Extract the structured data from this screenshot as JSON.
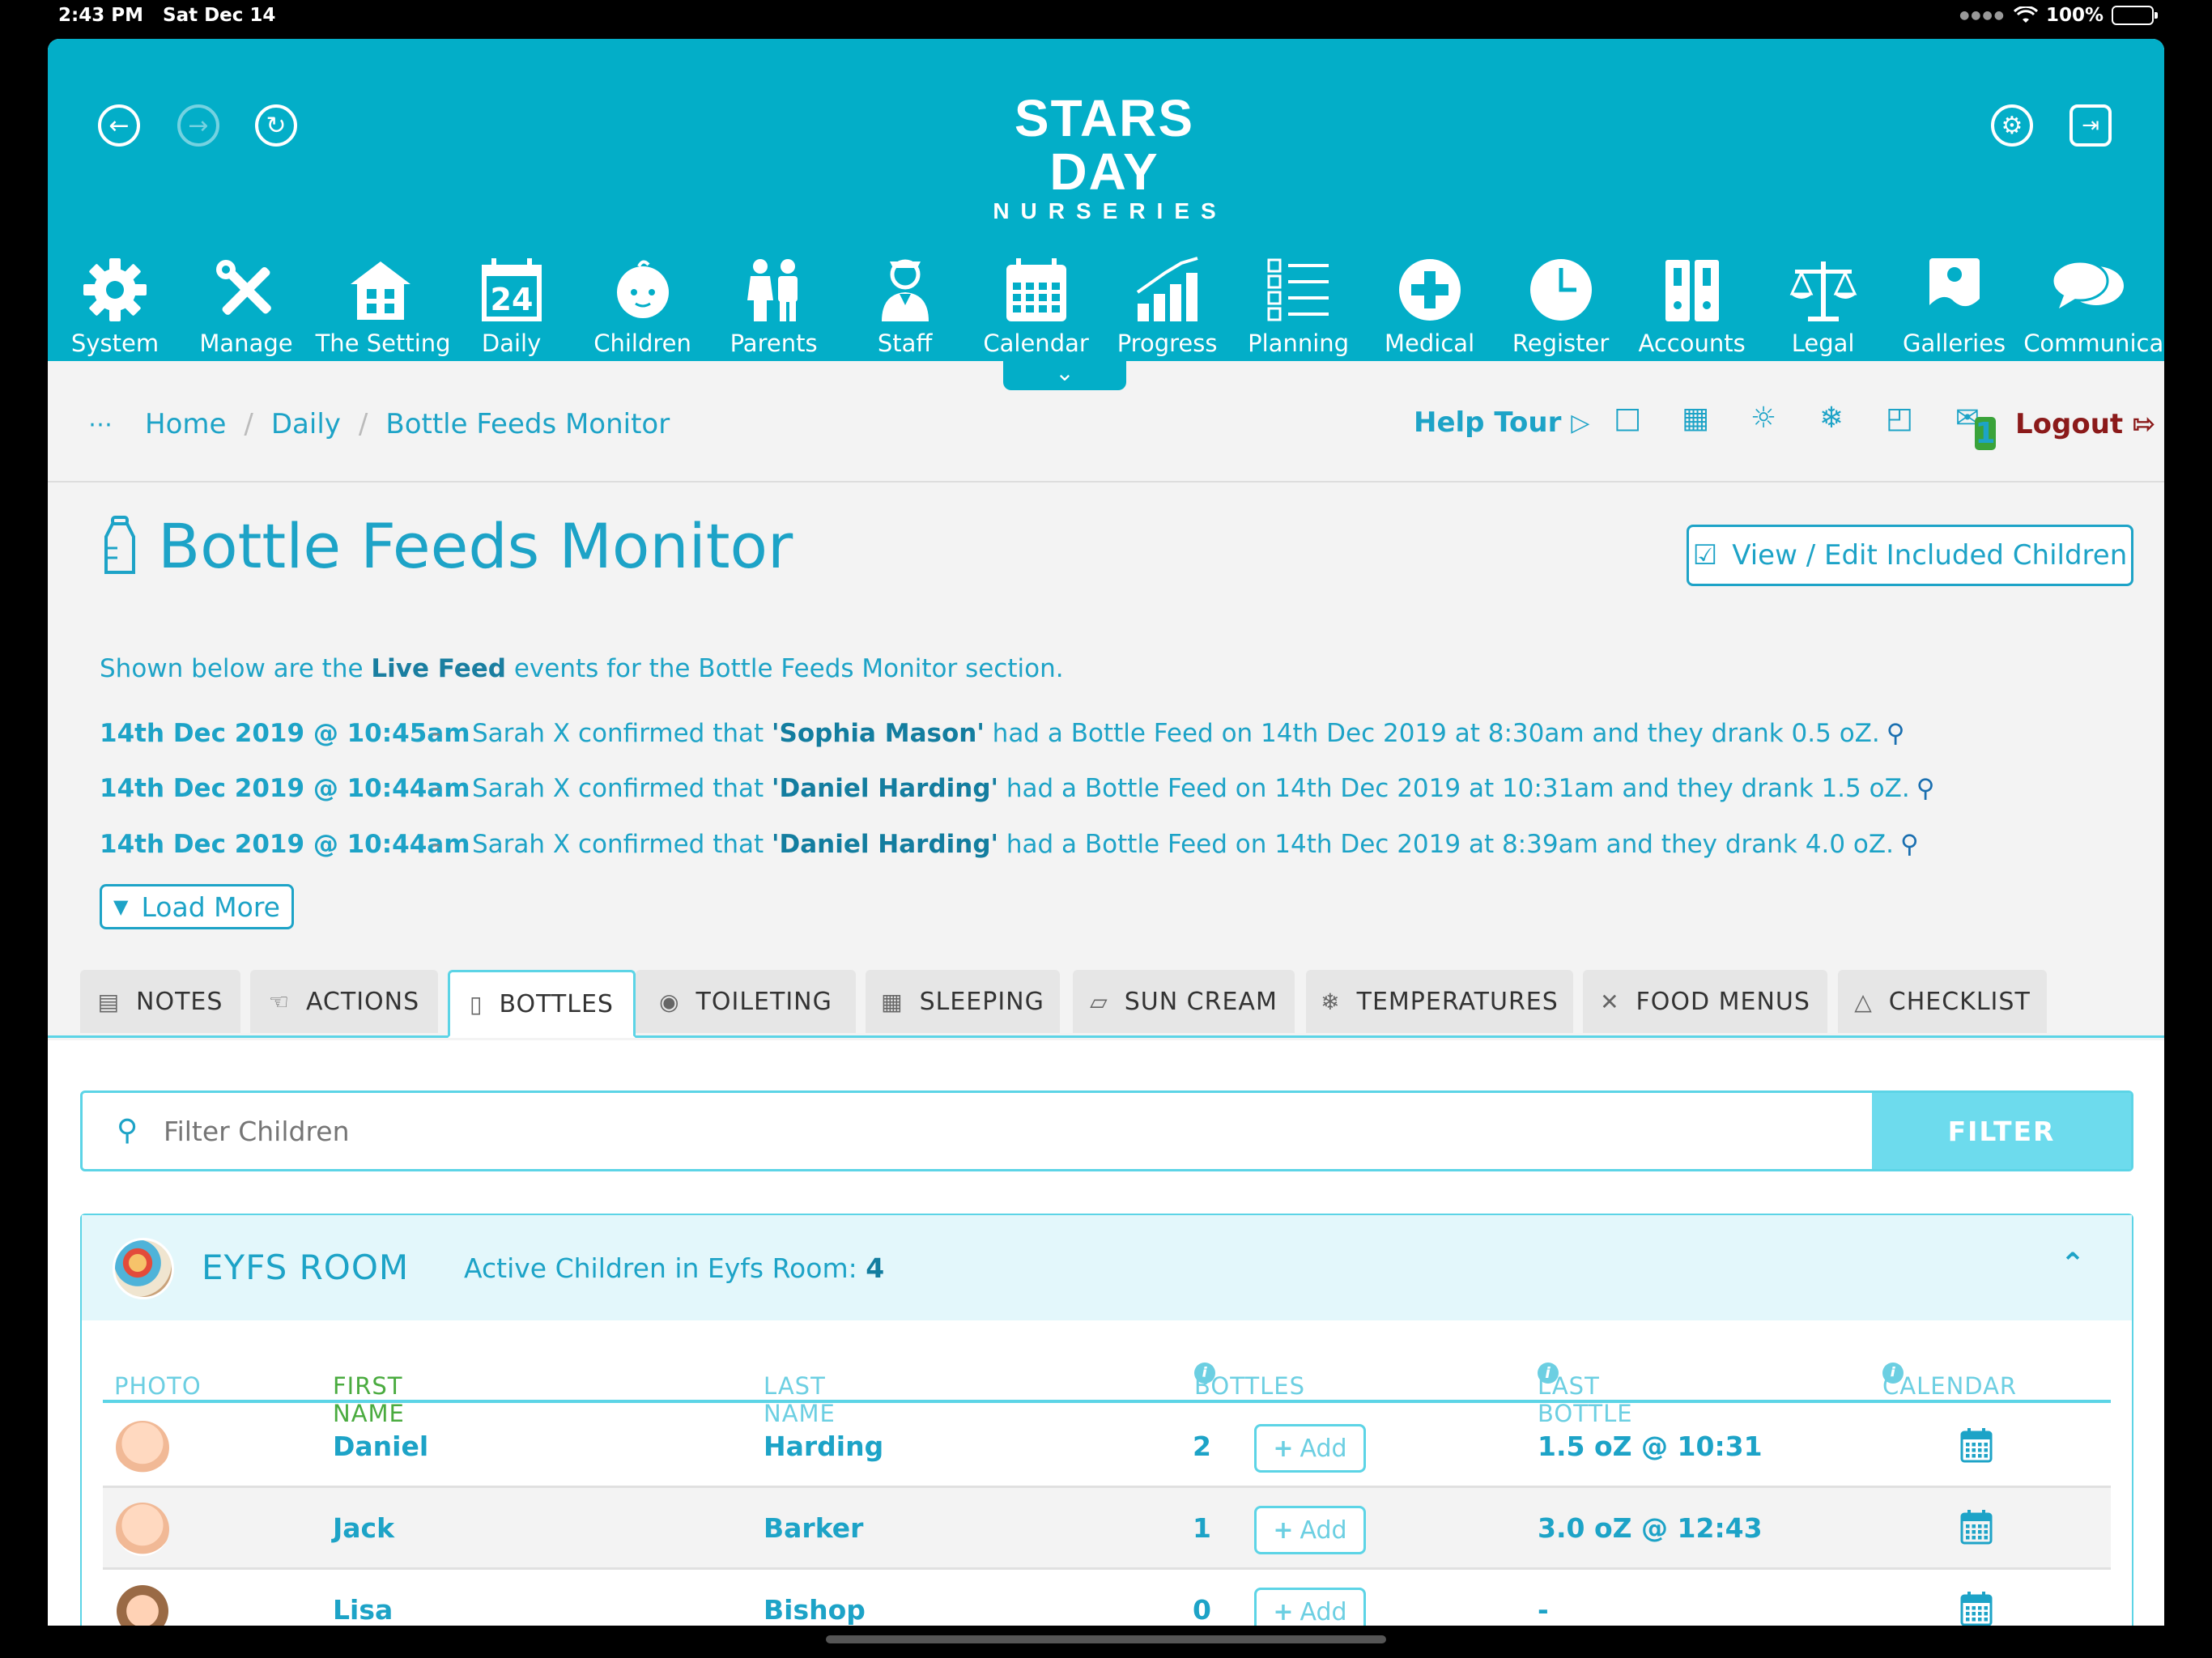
{
  "status": {
    "time": "2:43 PM",
    "date": "Sat Dec 14",
    "battery": "100%"
  },
  "brand": {
    "line1": "STARS DAY",
    "line2": "NURSERIES"
  },
  "nav": [
    {
      "label": "System",
      "icon": "gear-icon"
    },
    {
      "label": "Manage",
      "icon": "tools-icon"
    },
    {
      "label": "The Setting",
      "icon": "building-icon"
    },
    {
      "label": "Daily",
      "icon": "calendar-day-icon",
      "day": "24"
    },
    {
      "label": "Children",
      "icon": "baby-icon"
    },
    {
      "label": "Parents",
      "icon": "parents-icon"
    },
    {
      "label": "Staff",
      "icon": "staff-icon"
    },
    {
      "label": "Calendar",
      "icon": "calendar-grid-icon"
    },
    {
      "label": "Progress",
      "icon": "chart-icon"
    },
    {
      "label": "Planning",
      "icon": "checklist-icon"
    },
    {
      "label": "Medical",
      "icon": "medical-cross-icon"
    },
    {
      "label": "Register",
      "icon": "clock-icon"
    },
    {
      "label": "Accounts",
      "icon": "binders-icon"
    },
    {
      "label": "Legal",
      "icon": "scales-icon"
    },
    {
      "label": "Galleries",
      "icon": "gallery-icon"
    },
    {
      "label": "Communicate",
      "icon": "chat-bubbles-icon"
    }
  ],
  "breadcrumb": {
    "home": "Home",
    "daily": "Daily",
    "current": "Bottle Feeds Monitor"
  },
  "toolbar": {
    "help_tour": "Help Tour",
    "logout": "Logout",
    "mail_badge": "1"
  },
  "page": {
    "title": "Bottle Feeds Monitor",
    "edit_button": "View / Edit Included Children",
    "intro_pre": "Shown below are the ",
    "intro_bold": "Live Feed",
    "intro_post": " events for the Bottle Feeds Monitor section.",
    "load_more": "Load More"
  },
  "feed": [
    {
      "date": "14th Dec 2019 @ 10:45am",
      "pre": "Sarah X confirmed that ",
      "name": "'Sophia Mason'",
      "post": " had a Bottle Feed on 14th Dec 2019 at 8:30am and they drank 0.5 oZ."
    },
    {
      "date": "14th Dec 2019 @ 10:44am",
      "pre": "Sarah X confirmed that ",
      "name": "'Daniel Harding'",
      "post": " had a Bottle Feed on 14th Dec 2019 at 10:31am and they drank 1.5 oZ."
    },
    {
      "date": "14th Dec 2019 @ 10:44am",
      "pre": "Sarah X confirmed that ",
      "name": "'Daniel Harding'",
      "post": " had a Bottle Feed on 14th Dec 2019 at 8:39am and they drank 4.0 oZ."
    }
  ],
  "tabs": [
    "NOTES",
    "ACTIONS",
    "BOTTLES",
    "TOILETING",
    "SLEEPING",
    "SUN CREAM",
    "TEMPERATURES",
    "FOOD MENUS",
    "CHECKLIST"
  ],
  "filter": {
    "placeholder": "Filter Children",
    "button": "FILTER"
  },
  "room": {
    "name": "EYFS ROOM",
    "active_label": "Active Children in Eyfs Room: ",
    "active_count": "4",
    "columns": {
      "photo": "PHOTO",
      "first": "FIRST NAME",
      "last": "LAST NAME",
      "bottles": "BOTTLES",
      "last_bottle": "LAST BOTTLE",
      "calendar": "CALENDAR"
    },
    "add_label": "Add",
    "rows": [
      {
        "first": "Daniel",
        "last": "Harding",
        "bottles": "2",
        "last_bottle": "1.5 oZ @ 10:31"
      },
      {
        "first": "Jack",
        "last": "Barker",
        "bottles": "1",
        "last_bottle": "3.0 oZ @ 12:43"
      },
      {
        "first": "Lisa",
        "last": "Bishop",
        "bottles": "0",
        "last_bottle": "-"
      }
    ]
  }
}
